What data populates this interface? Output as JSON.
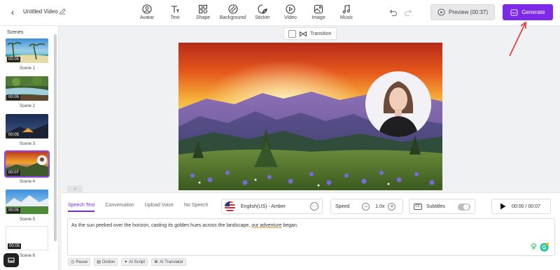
{
  "header": {
    "back": "‹",
    "title": "Untitled Video",
    "tools": [
      {
        "label": "Avatar",
        "icon": "avatar-icon"
      },
      {
        "label": "Text",
        "icon": "text-icon"
      },
      {
        "label": "Shape",
        "icon": "shape-icon"
      },
      {
        "label": "Background",
        "icon": "background-icon"
      },
      {
        "label": "Sticker",
        "icon": "sticker-icon"
      },
      {
        "label": "Video",
        "icon": "video-icon"
      },
      {
        "label": "Image",
        "icon": "image-icon"
      },
      {
        "label": "Music",
        "icon": "music-icon"
      }
    ],
    "preview_label": "Preview (00:37)",
    "generate_label": "Generate"
  },
  "sidebar": {
    "title": "Scenes",
    "scenes": [
      {
        "label": "Scene 1",
        "duration": "00:05"
      },
      {
        "label": "Scene 2",
        "duration": "00:05"
      },
      {
        "label": "Scene 3",
        "duration": "00:05"
      },
      {
        "label": "Scene 4",
        "duration": "00:07",
        "active": true
      },
      {
        "label": "Scene 5",
        "duration": "00:05"
      },
      {
        "label": "Scene 6",
        "duration": "00:05"
      }
    ]
  },
  "canvas": {
    "transition_label": "Transition"
  },
  "panel": {
    "tabs": [
      "Speech Text",
      "Conversation",
      "Upload Voice",
      "No Speech"
    ],
    "active_tab": "Speech Text",
    "voice": "English(US) - Amber",
    "speed_label": "Speed",
    "speed_value": "1.0x",
    "subtitles_label": "Subtitles",
    "cc_label": "CC",
    "time": "00:00 / 00:07",
    "speech_text_start": "As the sun peeked over the horizon, casting its golden hues across the landscape, ",
    "speech_text_underlined": "our adventure",
    "speech_text_end": " began.",
    "chips": [
      "Pause",
      "Diction",
      "AI Script",
      "AI Translator"
    ]
  },
  "colors": {
    "accent": "#7d2ae8",
    "generate_bg": "#7d2ae8",
    "arrow": "#e8312f"
  }
}
